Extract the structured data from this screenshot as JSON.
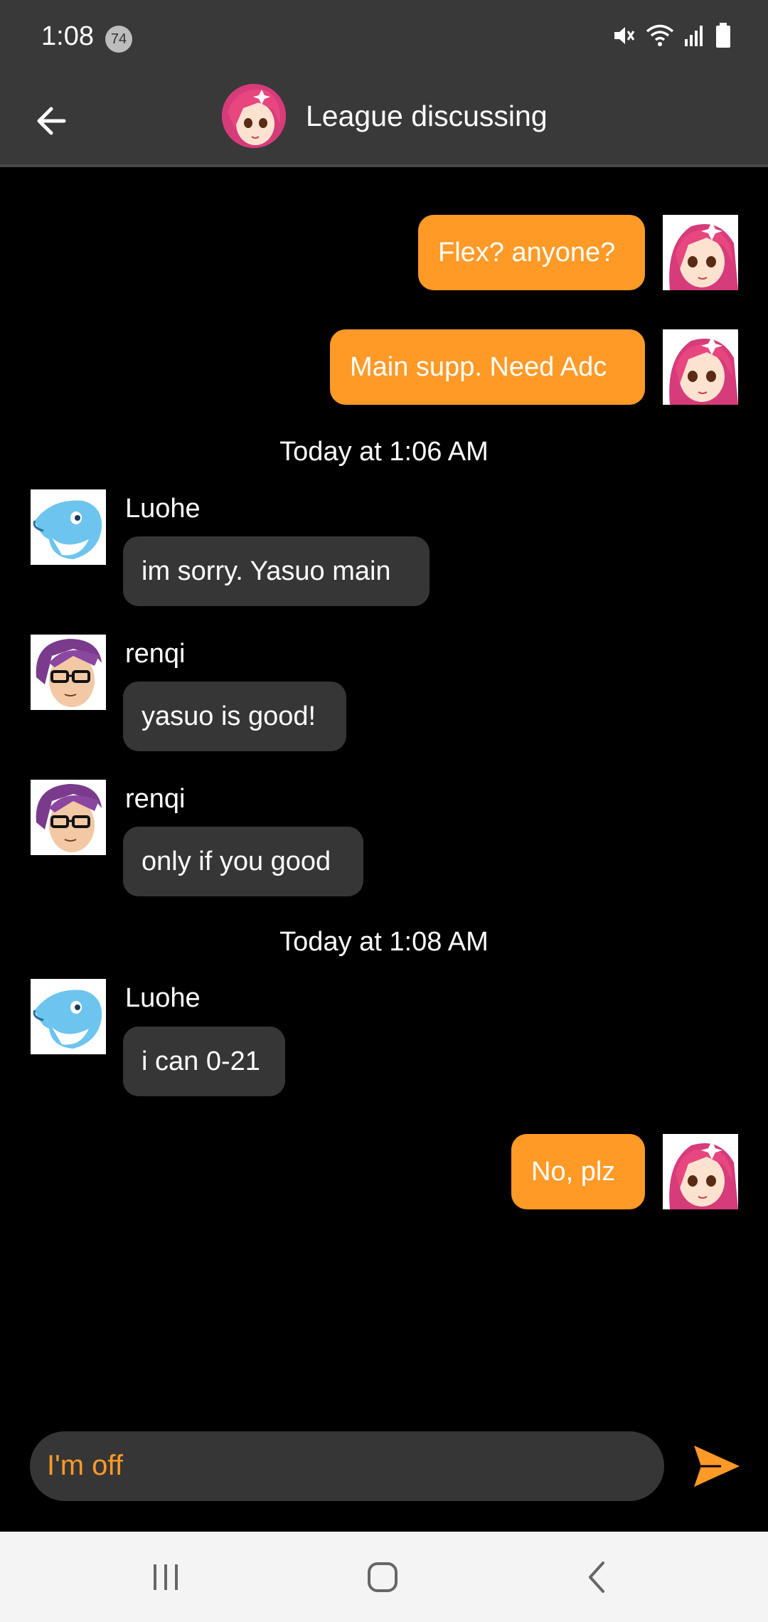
{
  "status_bar": {
    "time": "1:08",
    "notification_count": "74",
    "icons": [
      "mute-icon",
      "wifi-icon",
      "signal-icon",
      "battery-icon"
    ]
  },
  "header": {
    "back_icon": "arrow-left-icon",
    "title": "League discussing"
  },
  "messages": [
    {
      "type": "outgoing",
      "text": "Flex?  anyone?"
    },
    {
      "type": "outgoing",
      "text": "Main supp. Need Adc"
    },
    {
      "type": "timestamp",
      "text": "Today at 1:06 AM"
    },
    {
      "type": "incoming",
      "sender": "Luohe",
      "text": "im sorry. Yasuo main"
    },
    {
      "type": "incoming",
      "sender": "renqi",
      "text": "yasuo is good!"
    },
    {
      "type": "incoming",
      "sender": "renqi",
      "text": "only if you good"
    },
    {
      "type": "timestamp",
      "text": "Today at 1:08 AM"
    },
    {
      "type": "incoming",
      "sender": "Luohe",
      "text": "i can 0-21"
    },
    {
      "type": "outgoing",
      "text": "No, plz"
    }
  ],
  "composer": {
    "value": "I'm off",
    "send_icon": "send-icon"
  },
  "nav_bar": {
    "icons": [
      "recent-apps-icon",
      "home-icon",
      "back-icon"
    ]
  },
  "colors": {
    "accent": "#ff9a27",
    "bar": "#3a393a",
    "incoming_bubble": "#363636",
    "background": "#000000"
  }
}
